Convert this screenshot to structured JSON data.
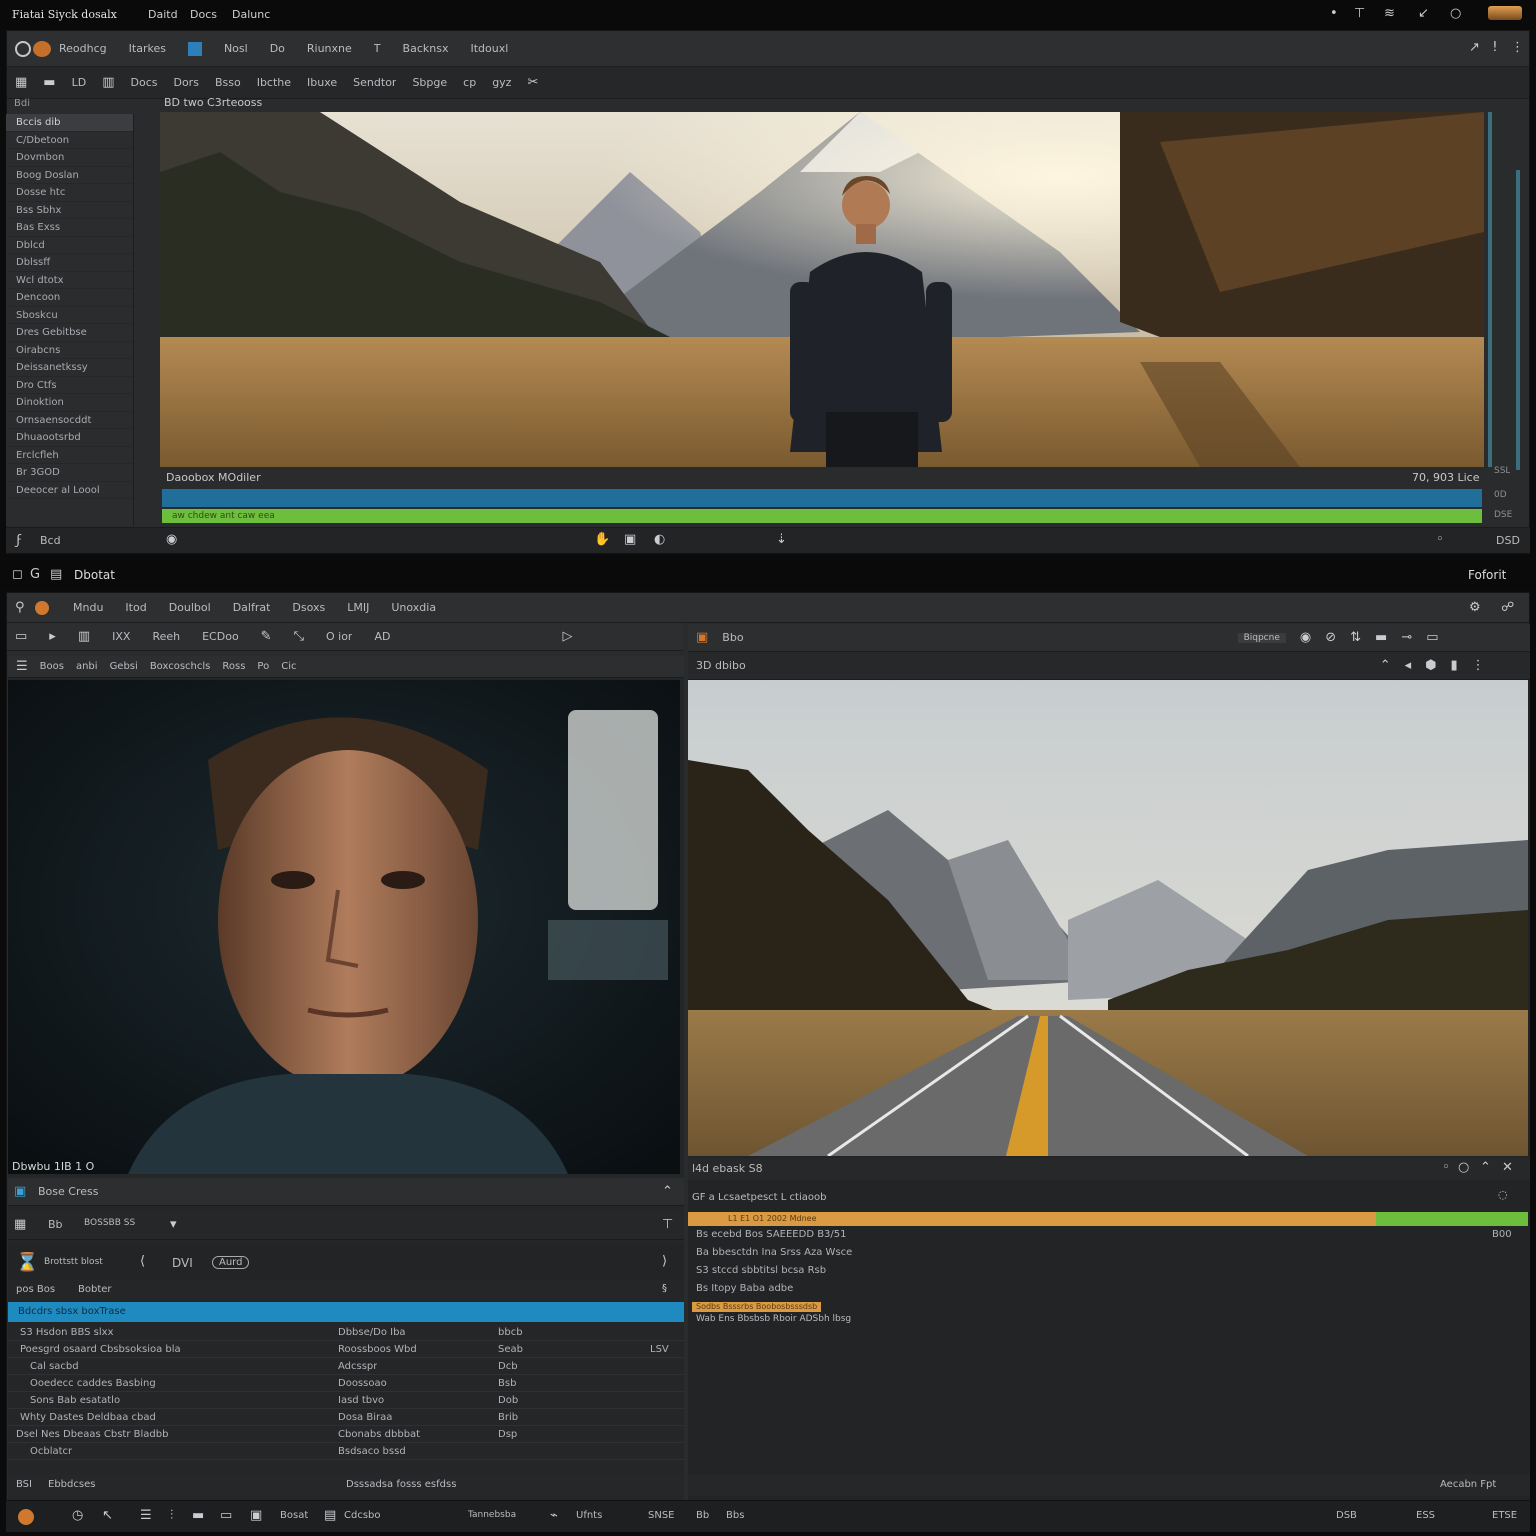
{
  "top": {
    "title_left": "Fiatai Siyck dosalx",
    "menu_extra": [
      "Daitd",
      "Docs",
      "Dalunc"
    ],
    "window_menu": [
      "Reodhcg",
      "Itarkes",
      "Nosl",
      "Do",
      "Riunxne",
      "T",
      "Backnsx",
      "Itdouxl"
    ],
    "toolbar": [
      "LD",
      "Docs",
      "Dors",
      "Bsso",
      "Ibcthe",
      "Ibuxe",
      "Sendtor",
      "Sbpge",
      "cp",
      "gyz"
    ],
    "panel_header": "BD two C3rteooss",
    "sidebar_header": "Bdi",
    "sidebar_items": [
      "Bccis dib",
      "C/Dbetoon",
      "Dovmbon",
      "Boog Doslan",
      "Dosse htc",
      "Bss Sbhx",
      "Bas Exss",
      "Dblcd",
      "Dblssff",
      "Wcl dtotx",
      "Dencoon",
      "Sboskcu",
      "Dres Gebitbse",
      "Oirabcns",
      "Deissanetkssy",
      "Dro Ctfs",
      "Dinoktion",
      "Ornsaensocddt",
      "Dhuaootsrbd",
      "Erclcfleh",
      "Br 3GOD",
      "Deeocer al Loool"
    ],
    "caption_left": "Daoobox MOdiler",
    "caption_right": "70, 903 Lice",
    "status_left": "Bcd",
    "track_text": "aw chdew ant caw eea",
    "side_values": [
      "SSL",
      "0D",
      "DSE",
      "DSD"
    ]
  },
  "bottom": {
    "title": "Dbotat",
    "title_right": "Foforit",
    "menu": [
      "Mndu",
      "Itod",
      "Doulbol",
      "Dalfrat",
      "Dsoxs",
      "LMIJ",
      "Unoxdia"
    ],
    "toolbar_left": [
      "IXX",
      "Reeh",
      "ECDoo",
      "O ior",
      "AD"
    ],
    "toolbar_right": [
      "Bbo",
      "Biqpcne"
    ],
    "tabs_left": [
      "Boos",
      "anbi",
      "Gebsi",
      "Boxcoschcls",
      "Ross",
      "Po",
      "Cic"
    ],
    "right_header": "3D dbibo",
    "left_caption": "Dbwbu 1IB 1 O",
    "right_caption": "l4d  ebask S8",
    "left_panel_title": "Bose  Cress",
    "left_toolbar": [
      "Bb",
      "BOSSBB SS"
    ],
    "left_control": [
      "Brottstt blost",
      "DVI",
      "Aurd"
    ],
    "left_sub": [
      "pos  Bos",
      "Bobter"
    ],
    "cyan_row": "Bdcdrs sbsx  boxTrase",
    "list_rows": [
      {
        "name": "S3 Hsdon BBS slxx",
        "col2": "Dbbse/Do Iba",
        "col3": "bbcb",
        "col4": ""
      },
      {
        "name": "Poesgrd osaard Cbsbsoksioa bla",
        "col2": "Roossboos Wbd",
        "col3": "Seab",
        "col4": "LSV"
      },
      {
        "name": "Cal sacbd",
        "col2": "Adcsspr",
        "col3": "Dcb",
        "col4": ""
      },
      {
        "name": "Ooedecc caddes Basbing",
        "col2": "Doossoao",
        "col3": "Bsb",
        "col4": ""
      },
      {
        "name": "Sons Bab esatatlo",
        "col2": "Iasd tbvo",
        "col3": "Dob",
        "col4": ""
      },
      {
        "name": "Whty Dastes  Deldbaa cbad",
        "col2": "Dosa Biraa",
        "col3": "Brib",
        "col4": ""
      },
      {
        "name": "Dsel Nes Dbeaas Cbstr Bladbb",
        "col2": "Cbonabs dbbbat",
        "col3": "Dsp",
        "col4": ""
      },
      {
        "name": "Ocblatcr",
        "col2": "Bsdsaco bssd",
        "col3": "",
        "col4": ""
      }
    ],
    "right_info_header": "GF a Lcsaetpesct L ctiaoob",
    "orange_track": "L1 E1 O1 2002 Mdnee",
    "right_rows": [
      "Bs  ecebd Bos SAEEEDD B3/51",
      "Ba bbesctdn  Ina Srss Aza Wsce",
      "S3  stccd  sbbtitsl  bcsa  Rsb",
      "Bs  Itopy Baba adbe"
    ],
    "right_row_aux": "B00",
    "orange_label": "Sodbs Bsssrbs Boobosbsssdsb",
    "right_note": "Wab Ens Bbsbsb Rboir ADSbh lbsg",
    "footer_left": [
      "BSI",
      "Ebbdcses"
    ],
    "footer_mid": "Dsssadsa fosss esfdss",
    "footer_right": "Aecabn  Fpt",
    "footer_tools": [
      "Bosat",
      "Cdcsbo",
      "Tannebsba",
      "Ufnts",
      "SNSE"
    ],
    "footer_right_tools": [
      "Bb",
      "Bbs",
      "DSB",
      "ESS",
      "ETSE"
    ]
  },
  "colors": {
    "blue_track": "#1f6f9a",
    "green_track": "#6cbe3c",
    "orange_track": "#d99a43",
    "cyan": "#1f8ac0"
  }
}
